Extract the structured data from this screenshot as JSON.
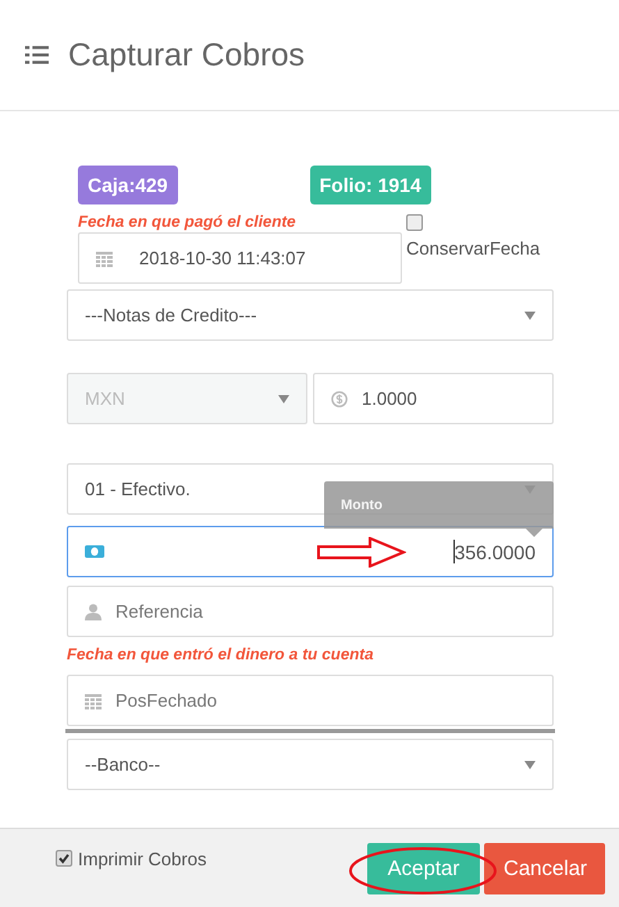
{
  "window": {
    "title": "Capturar Cobros"
  },
  "badges": [
    {
      "text": "Caja:429",
      "color": "#967adc"
    },
    {
      "text": "Folio: 1914",
      "color": "#37bc9b"
    }
  ],
  "payment_date": {
    "label": "Fecha en que pagó el cliente",
    "value": "2018-10-30 11:43:07"
  },
  "keep_date": {
    "label": "ConservarFecha",
    "checked": false
  },
  "credit_notes": {
    "value": "---Notas de Credito---"
  },
  "currency": {
    "value": "MXN",
    "disabled": true
  },
  "exchange_rate": {
    "value": "1.0000"
  },
  "payment_method": {
    "value": "01 - Efectivo."
  },
  "amount": {
    "tooltip": "Monto",
    "value": "356.0000",
    "focused": true
  },
  "reference": {
    "placeholder": "Referencia"
  },
  "post_date": {
    "label": "Fecha en que entró el dinero a tu cuenta",
    "placeholder": "PosFechado"
  },
  "bank": {
    "value": "--Banco--"
  },
  "footer": {
    "print": {
      "label": "Imprimir Cobros",
      "checked": true
    },
    "buttons": [
      {
        "label": "Aceptar",
        "kind": "primary"
      },
      {
        "label": "Cancelar",
        "kind": "danger"
      }
    ]
  }
}
